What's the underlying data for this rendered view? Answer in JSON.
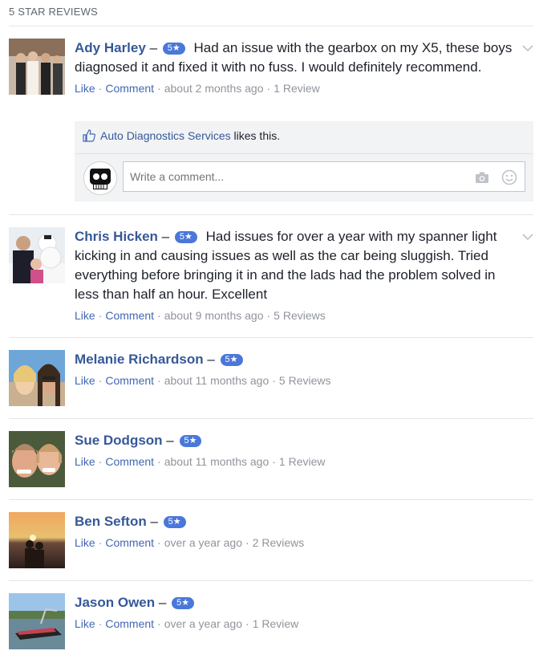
{
  "section": {
    "title": "5 STAR REVIEWS"
  },
  "common": {
    "like": "Like",
    "comment": "Comment",
    "dash": "–",
    "badge": "5★"
  },
  "reviews": [
    {
      "name": "Ady Harley",
      "text": "Had an issue with the gearbox on my X5, these boys diagnosed it and fixed it with no fuss. I would definitely recommend.",
      "time": "about 2 months ago",
      "review_count": "1 Review",
      "likes": {
        "page": "Auto Diagnostics Services",
        "suffix": "likes this."
      },
      "comment_placeholder": "Write a comment..."
    },
    {
      "name": "Chris Hicken",
      "text": "Had issues for over a year with my spanner light kicking in and causing issues as well as the car being sluggish. Tried everything before bringing it in and the lads had the problem solved in less than half an hour. Excellent",
      "time": "about 9 months ago",
      "review_count": "5 Reviews"
    },
    {
      "name": "Melanie Richardson",
      "time": "about 11 months ago",
      "review_count": "5 Reviews"
    },
    {
      "name": "Sue Dodgson",
      "time": "about 11 months ago",
      "review_count": "1 Review"
    },
    {
      "name": "Ben Sefton",
      "time": "over a year ago",
      "review_count": "2 Reviews"
    },
    {
      "name": "Jason Owen",
      "time": "over a year ago",
      "review_count": "1 Review"
    }
  ],
  "icons": {
    "chevron": "chevron-down-icon",
    "thumb": "thumbs-up-icon",
    "camera": "camera-icon",
    "smiley": "smiley-icon"
  },
  "colors": {
    "name_link": "#365899",
    "action_link": "#4267b2",
    "badge": "#4a77d9",
    "meta": "#90949c"
  }
}
